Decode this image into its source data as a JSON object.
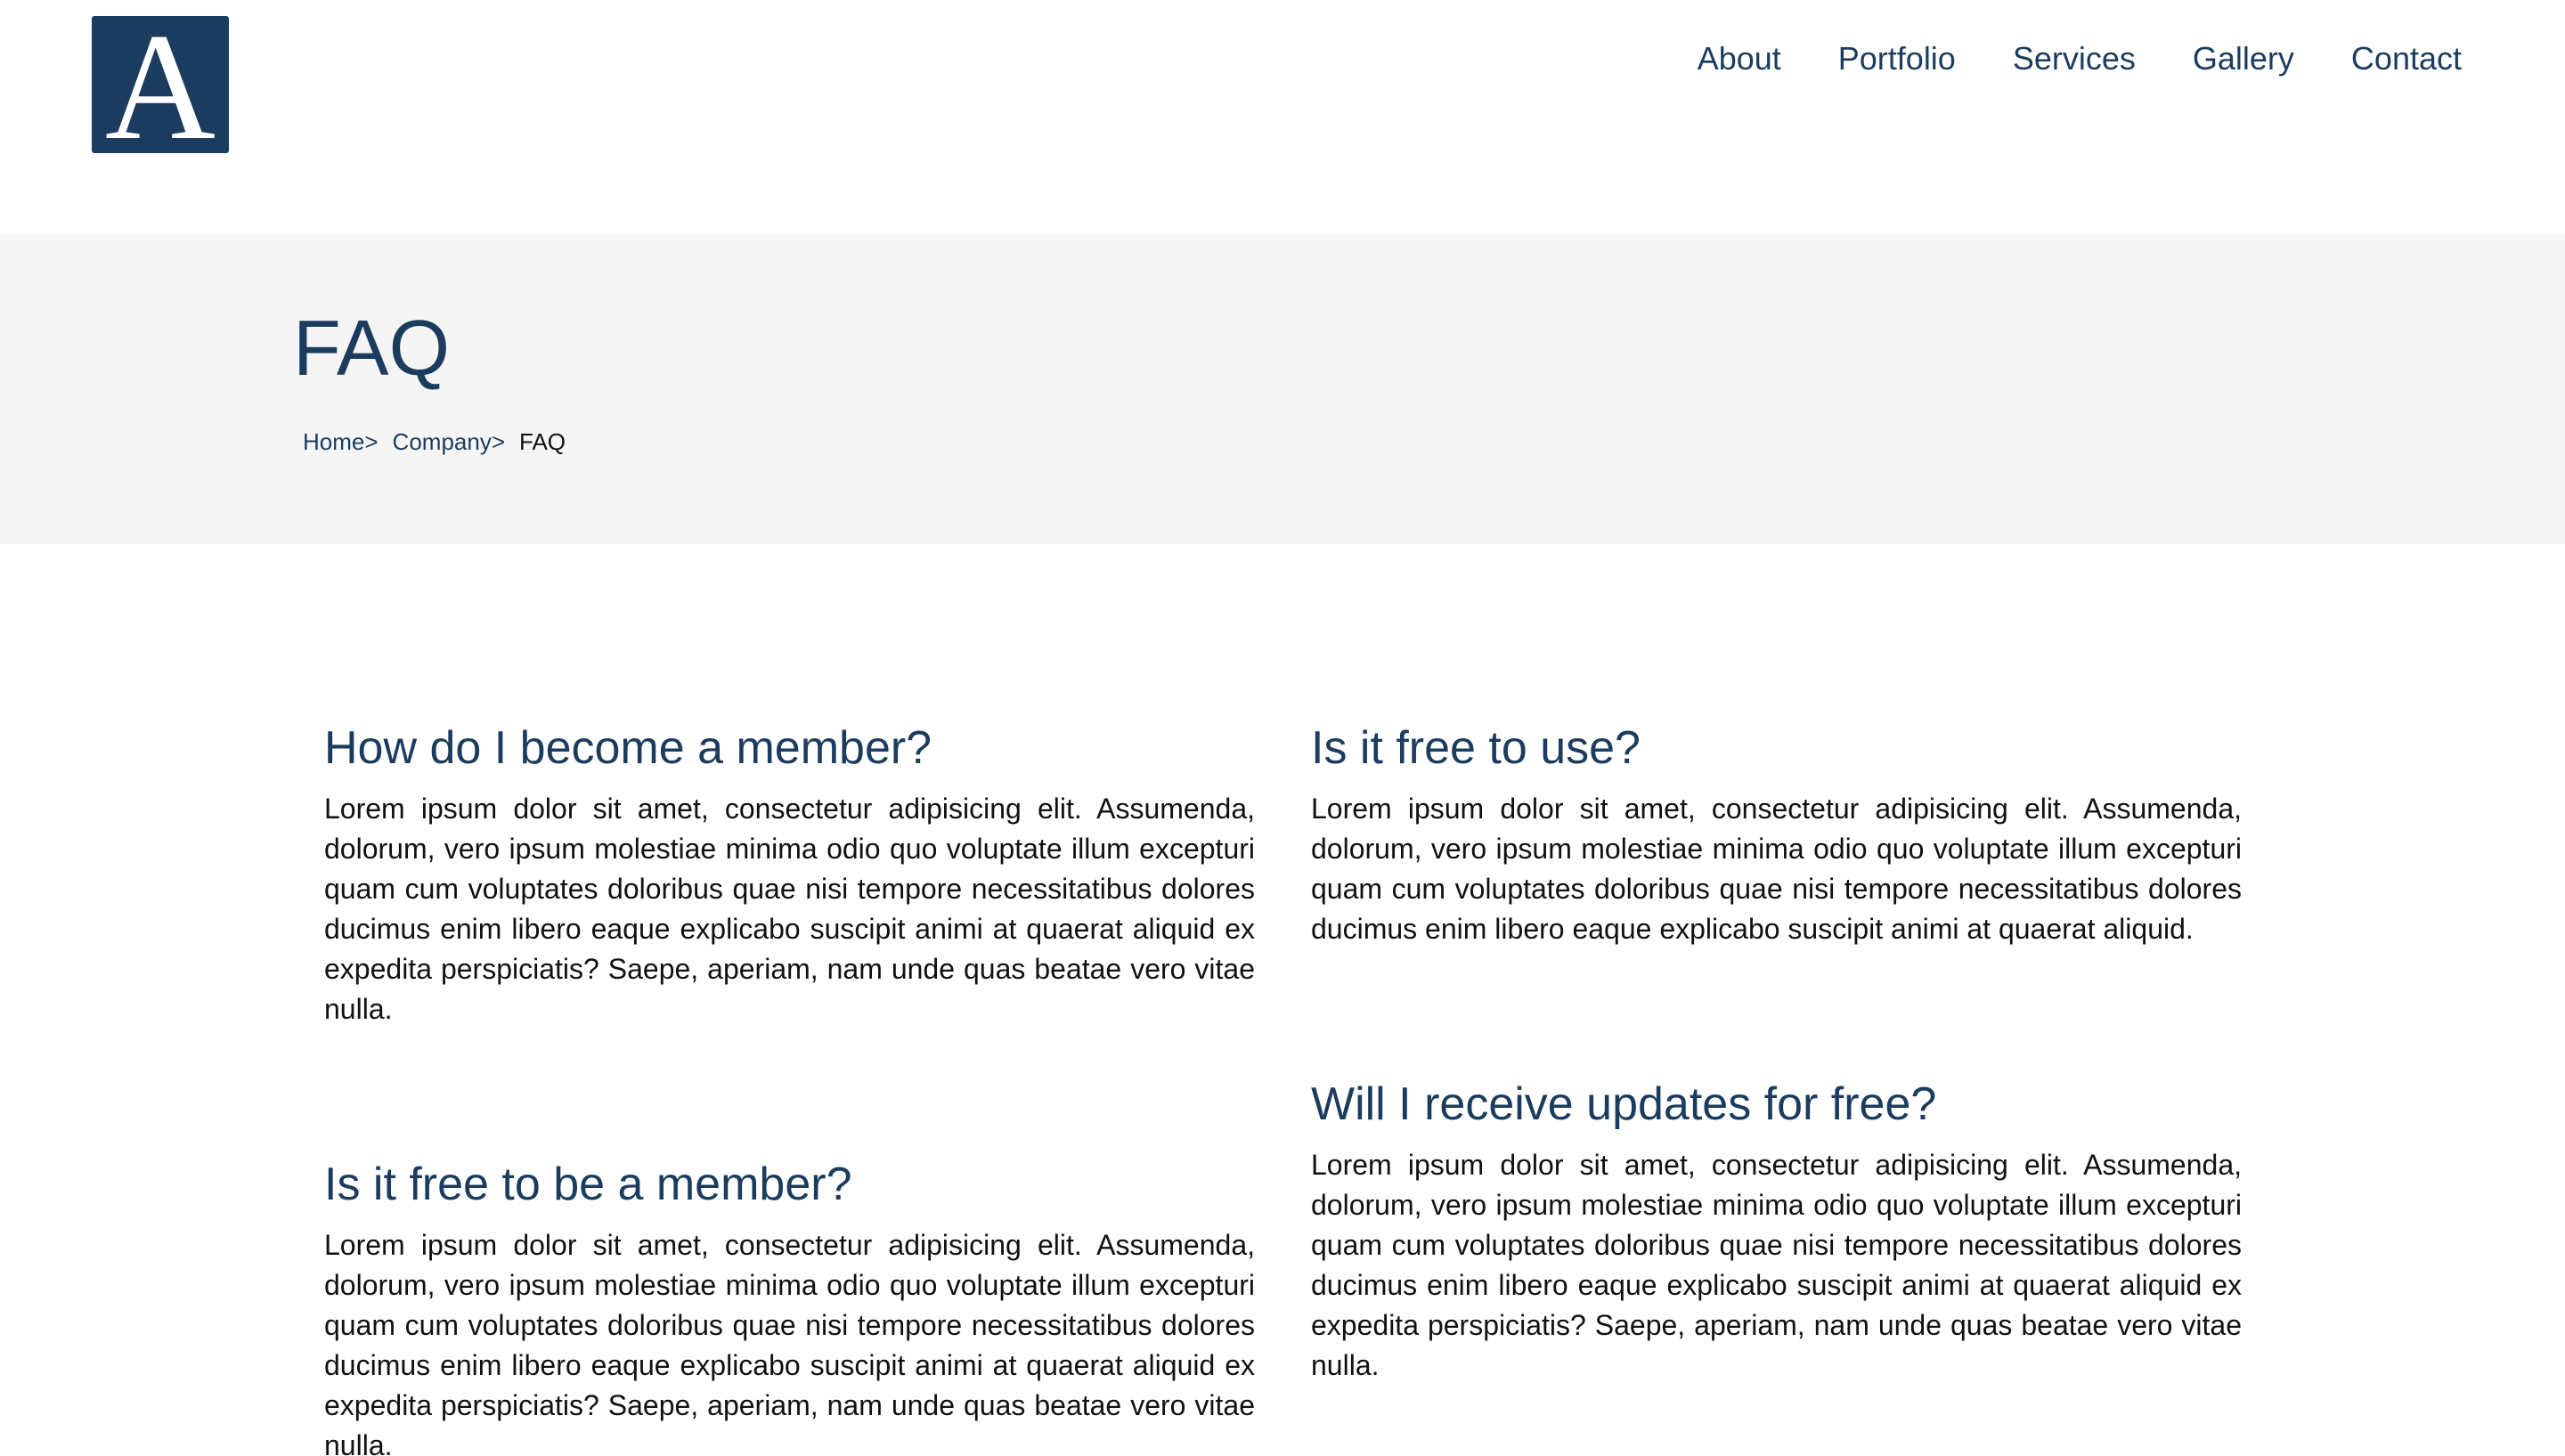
{
  "header": {
    "logo_letter": "A",
    "nav": [
      {
        "label": "About"
      },
      {
        "label": "Portfolio"
      },
      {
        "label": "Services"
      },
      {
        "label": "Gallery"
      },
      {
        "label": "Contact"
      }
    ]
  },
  "hero": {
    "title": "FAQ",
    "breadcrumb": {
      "home": "Home",
      "company": "Company",
      "separator": ">",
      "current": "FAQ"
    }
  },
  "faq": {
    "left": [
      {
        "question": "How do I become a member?",
        "answer": "Lorem ipsum dolor sit amet, consectetur adipisicing elit. Assumenda, dolorum, vero ipsum molestiae minima odio quo voluptate illum excepturi quam cum voluptates doloribus quae nisi tempore necessitatibus dolores ducimus enim libero eaque explicabo suscipit animi at quaerat aliquid ex expedita perspiciatis? Saepe, aperiam, nam unde quas beatae vero vitae nulla."
      },
      {
        "question": "Is it free to be a member?",
        "answer": "Lorem ipsum dolor sit amet, consectetur adipisicing elit. Assumenda, dolorum, vero ipsum molestiae minima odio quo voluptate illum excepturi quam cum voluptates doloribus quae nisi tempore necessitatibus dolores ducimus enim libero eaque explicabo suscipit animi at quaerat aliquid ex expedita perspiciatis? Saepe, aperiam, nam unde quas beatae vero vitae nulla."
      }
    ],
    "right": [
      {
        "question": "Is it free to use?",
        "answer": "Lorem ipsum dolor sit amet, consectetur adipisicing elit. Assumenda, dolorum, vero ipsum molestiae minima odio quo voluptate illum excepturi quam cum voluptates doloribus quae nisi tempore necessitatibus dolores ducimus enim libero eaque explicabo suscipit animi at quaerat aliquid."
      },
      {
        "question": "Will I receive updates for free?",
        "answer": "Lorem ipsum dolor sit amet, consectetur adipisicing elit. Assumenda, dolorum, vero ipsum molestiae minima odio quo voluptate illum excepturi quam cum voluptates doloribus quae nisi tempore necessitatibus dolores ducimus enim libero eaque explicabo suscipit animi at quaerat aliquid ex expedita perspiciatis? Saepe, aperiam, nam unde quas beatae vero vitae nulla."
      }
    ]
  },
  "colors": {
    "brand": "#1b3c5e",
    "hero_background": "#f5f5f5",
    "text": "#111111"
  }
}
